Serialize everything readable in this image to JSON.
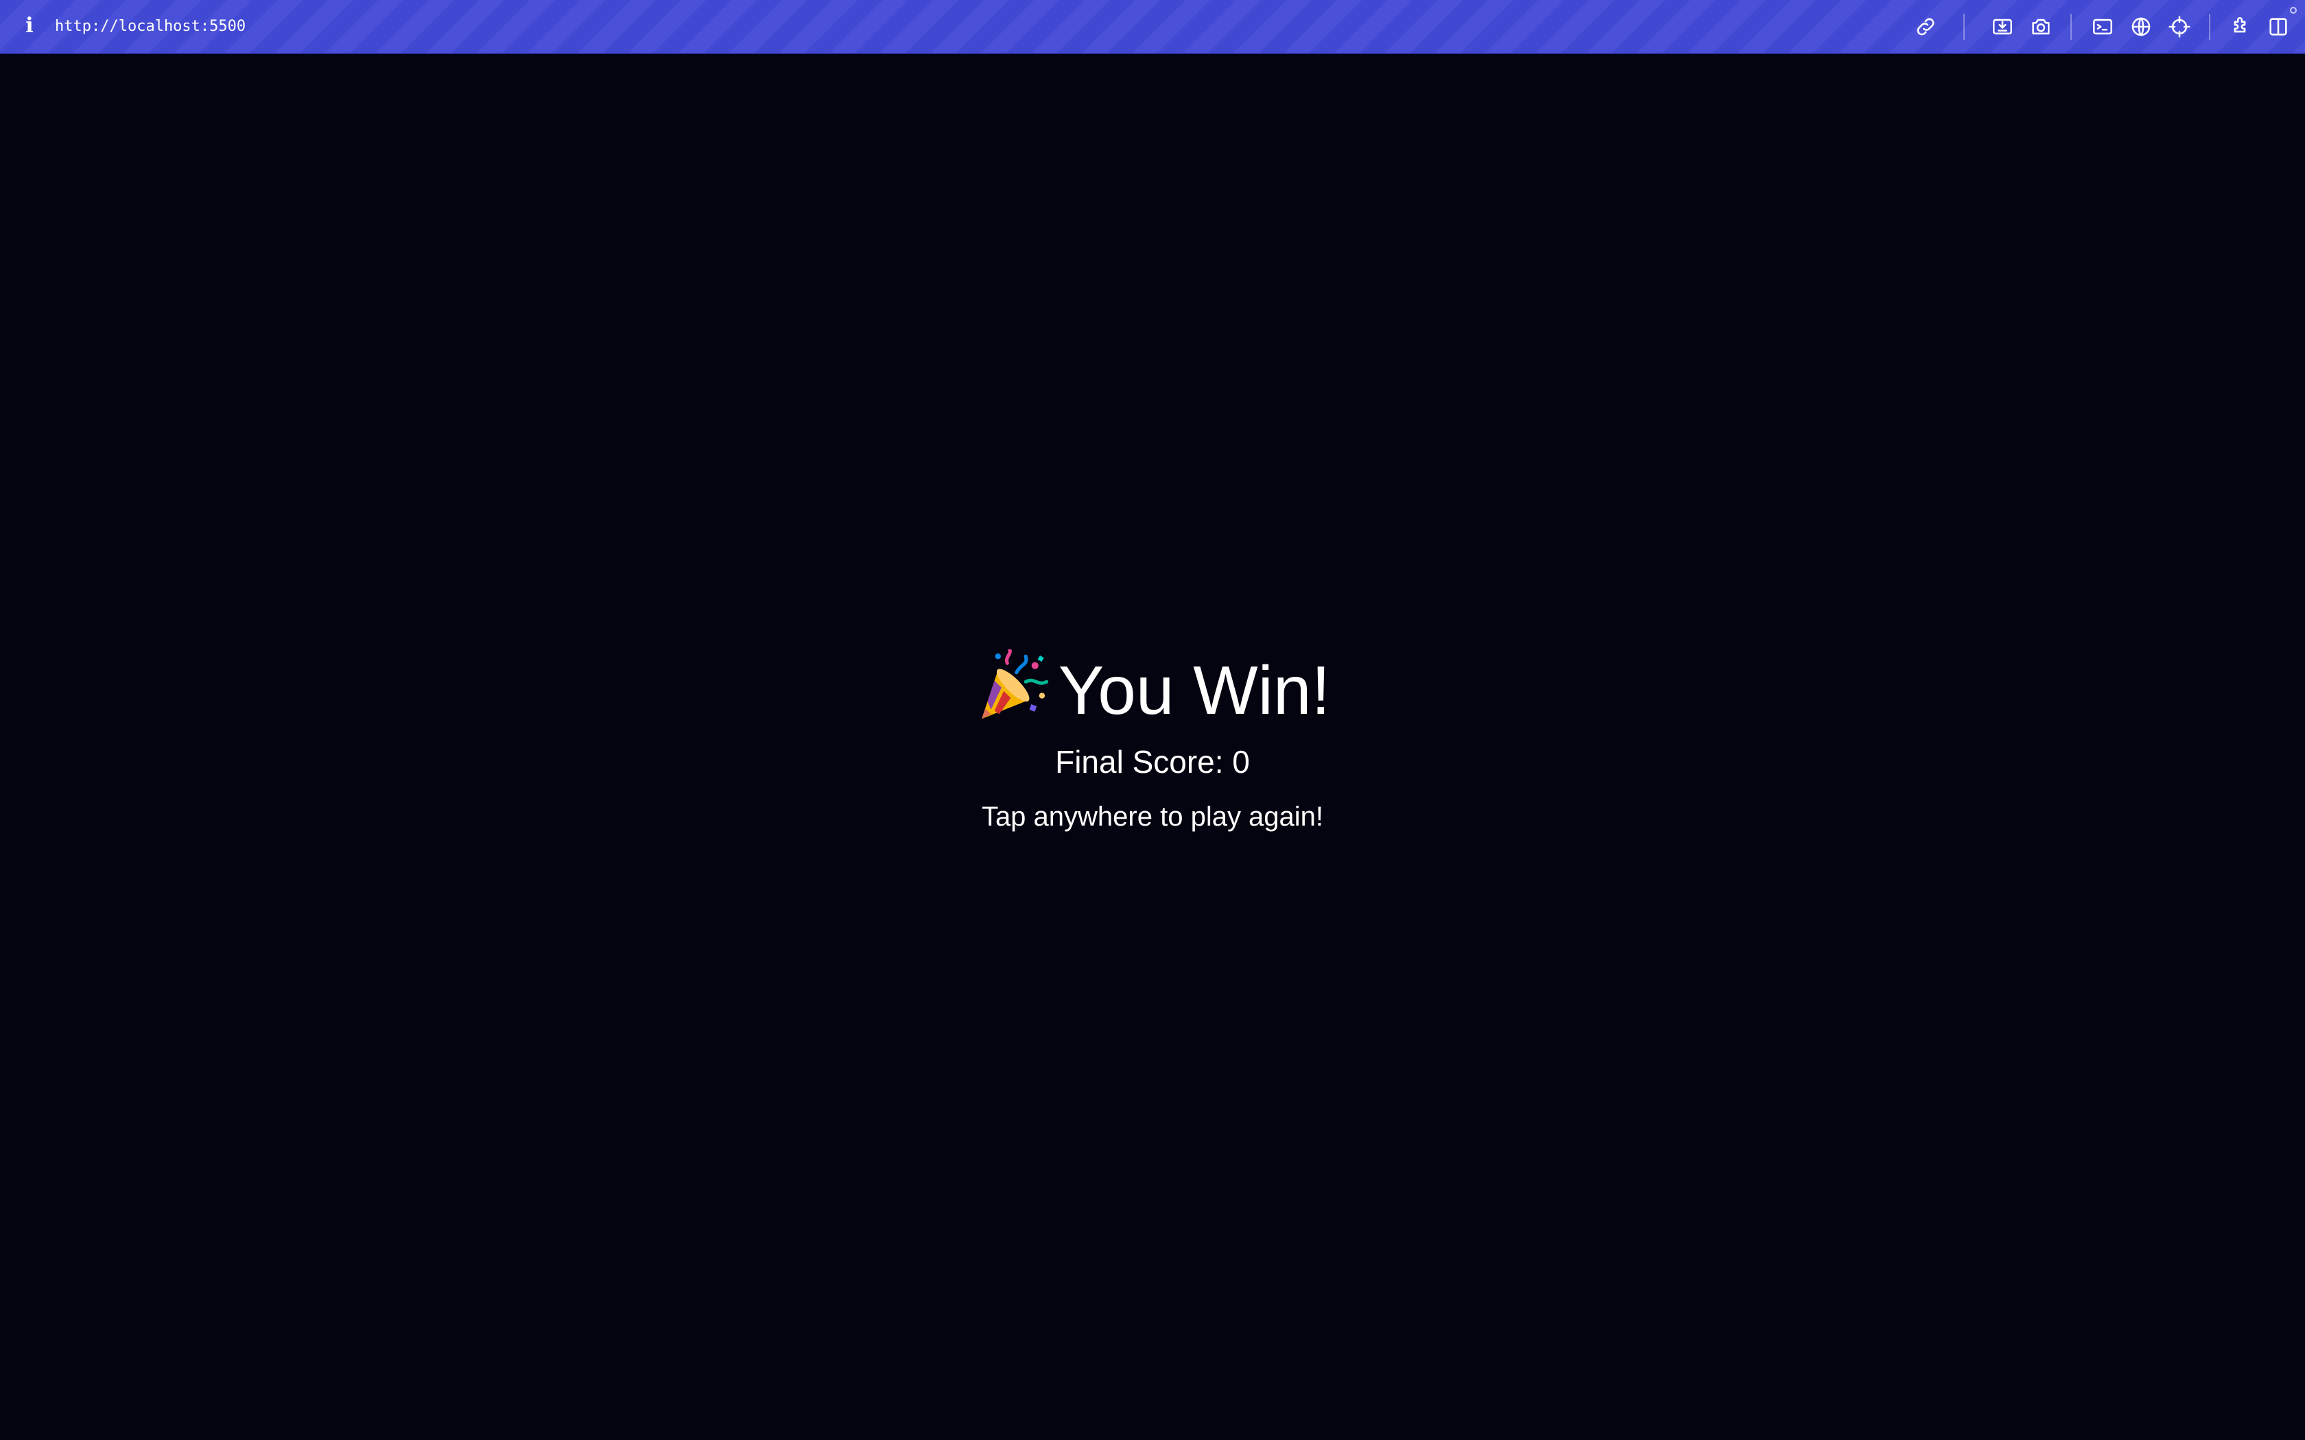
{
  "browser": {
    "url": "http://localhost:5500",
    "info_icon": "i",
    "toolbar_icons": [
      "link-icon",
      "screencast-icon",
      "camera-icon",
      "terminal-icon",
      "globe-icon",
      "crosshair-icon",
      "extensions-icon",
      "split-view-icon"
    ],
    "accent_color": "#4148d2"
  },
  "game": {
    "background_color": "#03040f",
    "title_icon": "party-popper-icon",
    "title": "You Win!",
    "final_score": "Final Score: 0",
    "hint": "Tap anywhere to play again!"
  }
}
